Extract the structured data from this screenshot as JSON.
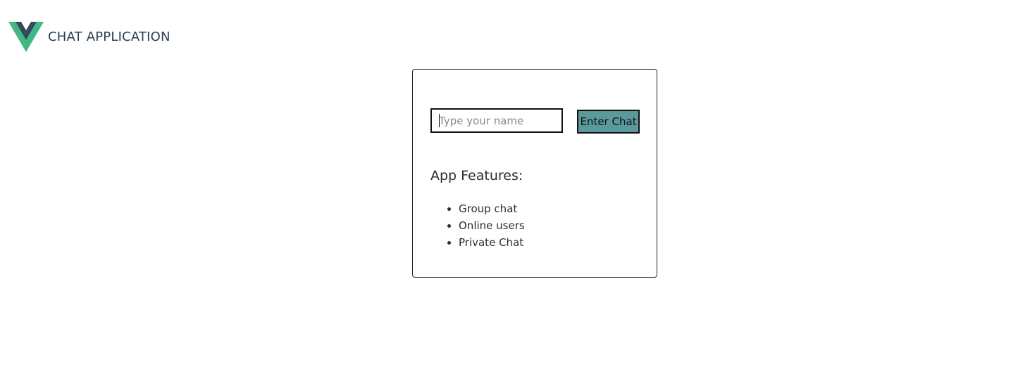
{
  "header": {
    "logo_icon": "vue-logo-icon",
    "title": "CHAT APPLICATION",
    "logo_colors": {
      "outer": "#41b883",
      "inner": "#35495e"
    }
  },
  "login_card": {
    "name_input": {
      "value": "",
      "placeholder": "Type your name"
    },
    "enter_button_label": "Enter Chat",
    "enter_button_color": "#5b9a9c",
    "features_title": "App Features:",
    "features": [
      "Group chat",
      "Online users",
      "Private Chat"
    ]
  }
}
